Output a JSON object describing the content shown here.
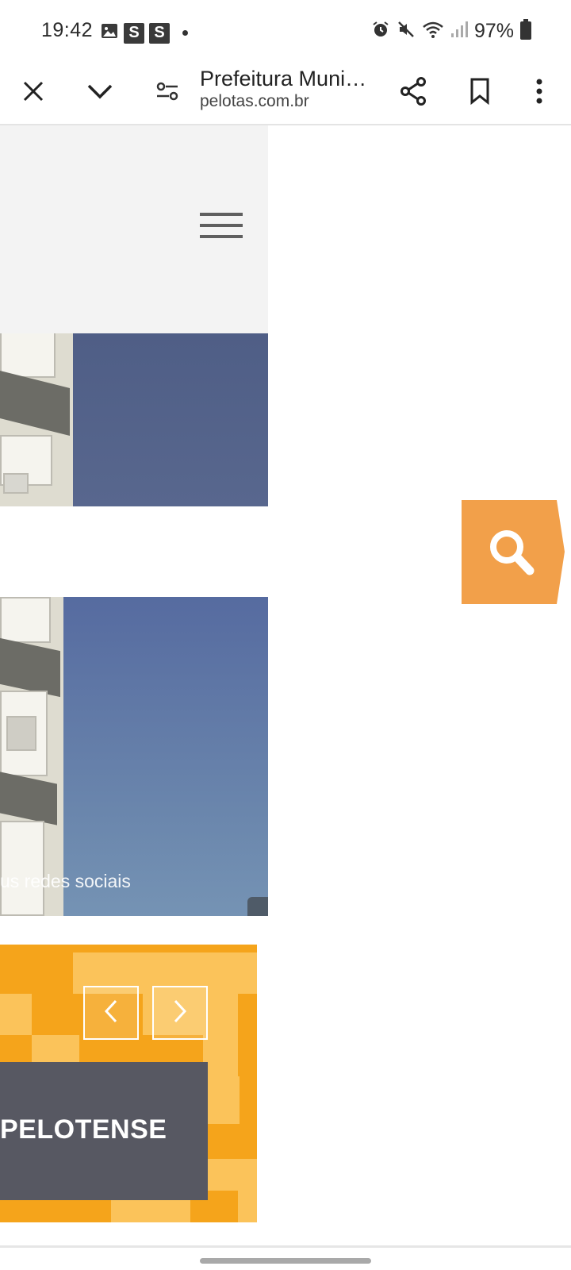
{
  "status_bar": {
    "time": "19:42",
    "left_icons": [
      "image-icon",
      "s-icon",
      "s-icon",
      "dot-icon"
    ],
    "s_letter": "S",
    "battery": "97%",
    "right_icons": [
      "alarm-icon",
      "mute-icon",
      "wifi-icon",
      "signal-icon",
      "battery-icon"
    ]
  },
  "browser": {
    "page_title": "Prefeitura Muni…",
    "url": "pelotas.com.br",
    "icons": [
      "close-icon",
      "chevron-down-icon",
      "site-settings-icon",
      "share-icon",
      "bookmark-icon",
      "more-vert-icon"
    ]
  },
  "site": {
    "menu_icon": "hamburger-menu-icon",
    "photo_caption": "us redes sociais",
    "search_icon": "search-icon",
    "banner_text": "PELOTENSE",
    "banner_prev_icon": "chevron-left-icon",
    "banner_next_icon": "chevron-right-icon"
  },
  "colors": {
    "accent_orange": "#f2a04a",
    "banner_orange": "#f5a41b",
    "banner_dark": "#575862",
    "sky_blue": "#566ba0"
  }
}
